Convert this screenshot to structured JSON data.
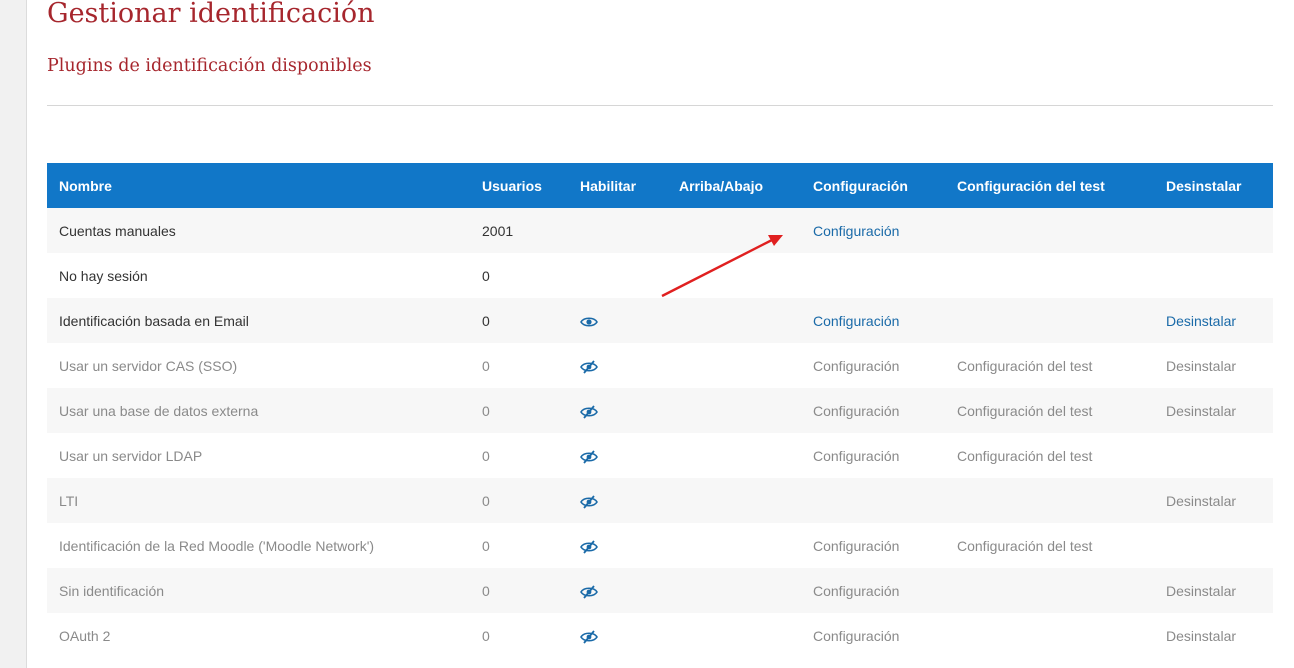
{
  "page": {
    "title": "Gestionar identificación",
    "section_title": "Plugins de identificación disponibles"
  },
  "table": {
    "headers": {
      "name": "Nombre",
      "users": "Usuarios",
      "enable": "Habilitar",
      "updown": "Arriba/Abajo",
      "settings": "Configuración",
      "test": "Configuración del test",
      "uninstall": "Desinstalar"
    },
    "rows": [
      {
        "name": "Cuentas manuales",
        "users": "2001",
        "enable_icon": "",
        "settings": "Configuración",
        "test": "",
        "uninstall": "",
        "enabled": true
      },
      {
        "name": "No hay sesión",
        "users": "0",
        "enable_icon": "",
        "settings": "",
        "test": "",
        "uninstall": "",
        "enabled": true
      },
      {
        "name": "Identificación basada en Email",
        "users": "0",
        "enable_icon": "eye-icon",
        "settings": "Configuración",
        "test": "",
        "uninstall": "Desinstalar",
        "enabled": true
      },
      {
        "name": "Usar un servidor CAS (SSO)",
        "users": "0",
        "enable_icon": "eye-slash-icon",
        "settings": "Configuración",
        "test": "Configuración del test",
        "uninstall": "Desinstalar",
        "enabled": false
      },
      {
        "name": "Usar una base de datos externa",
        "users": "0",
        "enable_icon": "eye-slash-icon",
        "settings": "Configuración",
        "test": "Configuración del test",
        "uninstall": "Desinstalar",
        "enabled": false
      },
      {
        "name": "Usar un servidor LDAP",
        "users": "0",
        "enable_icon": "eye-slash-icon",
        "settings": "Configuración",
        "test": "Configuración del test",
        "uninstall": "",
        "enabled": false
      },
      {
        "name": "LTI",
        "users": "0",
        "enable_icon": "eye-slash-icon",
        "settings": "",
        "test": "",
        "uninstall": "Desinstalar",
        "enabled": false
      },
      {
        "name": "Identificación de la Red Moodle ('Moodle Network')",
        "users": "0",
        "enable_icon": "eye-slash-icon",
        "settings": "Configuración",
        "test": "Configuración del test",
        "uninstall": "",
        "enabled": false
      },
      {
        "name": "Sin identificación",
        "users": "0",
        "enable_icon": "eye-slash-icon",
        "settings": "Configuración",
        "test": "",
        "uninstall": "Desinstalar",
        "enabled": false
      },
      {
        "name": "OAuth 2",
        "users": "0",
        "enable_icon": "eye-slash-icon",
        "settings": "Configuración",
        "test": "",
        "uninstall": "Desinstalar",
        "enabled": false
      }
    ]
  },
  "colors": {
    "heading": "#a6262d",
    "table_header_bg": "#1177c8",
    "link": "#1a6aa8",
    "icon": "#1a6aa8",
    "annotation_arrow": "#e02020"
  }
}
